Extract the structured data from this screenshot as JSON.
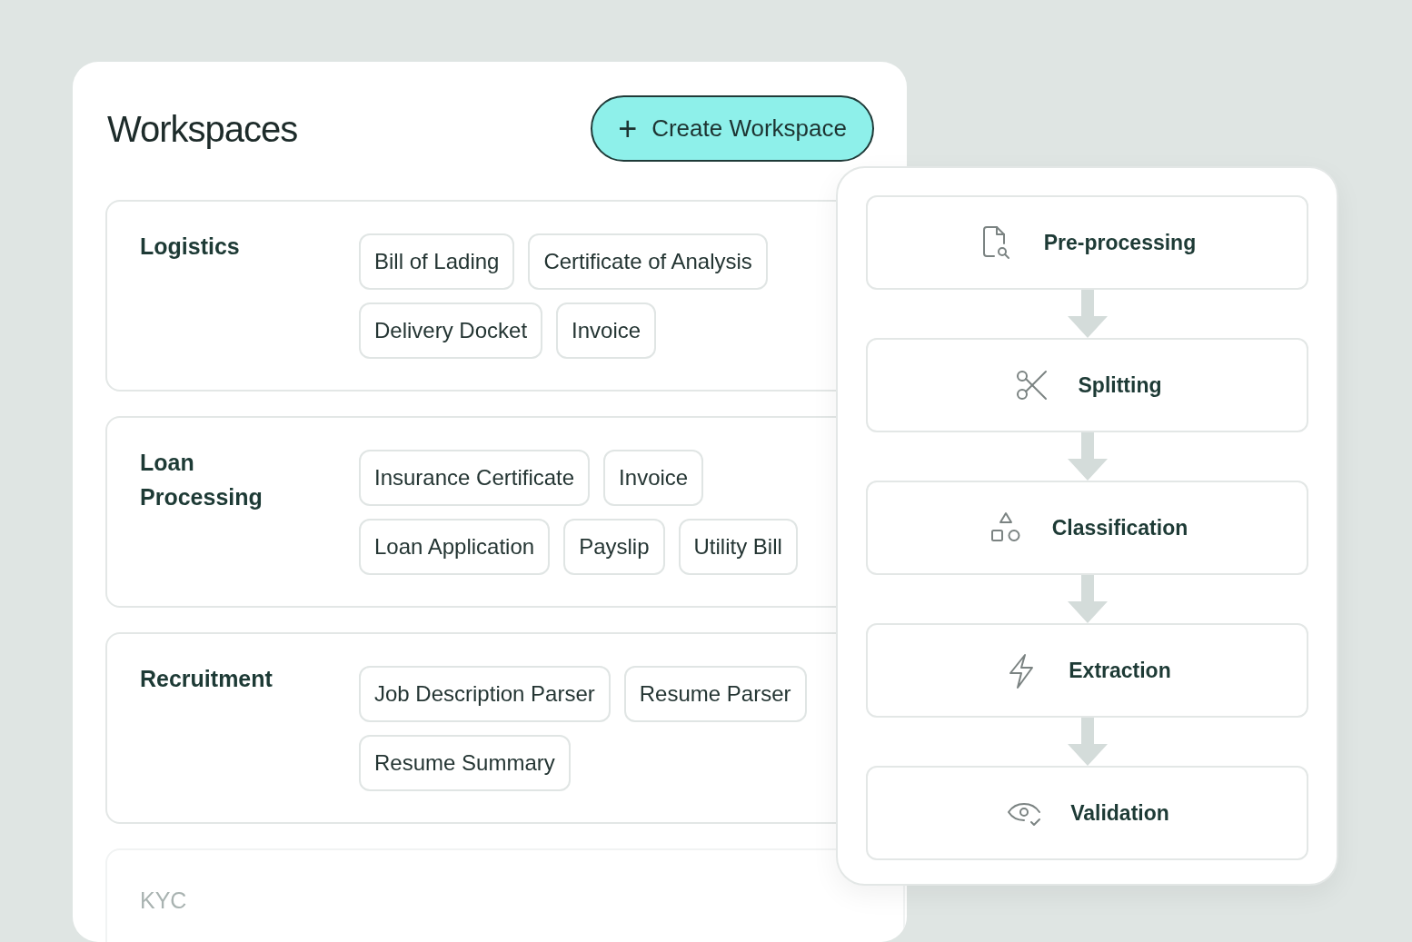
{
  "title": "Workspaces",
  "create_button": {
    "icon": "+",
    "label": "Create Workspace"
  },
  "workspaces": [
    {
      "name": "Logistics",
      "faded": false,
      "tag_rows": [
        [
          "Bill of Lading",
          "Certificate of Analysis"
        ],
        [
          "Delivery Docket",
          "Invoice"
        ]
      ]
    },
    {
      "name": "Loan Processing",
      "faded": false,
      "tag_rows": [
        [
          "Insurance Certificate",
          "Invoice"
        ],
        [
          "Loan Application",
          "Payslip",
          "Utility Bill"
        ]
      ]
    },
    {
      "name": "Recruitment",
      "faded": false,
      "tag_rows": [
        [
          "Job Description Parser",
          "Resume Parser"
        ],
        [
          "Resume Summary"
        ]
      ]
    },
    {
      "name": "KYC",
      "faded": true
    }
  ],
  "pipeline": [
    {
      "kind": "file-search",
      "label": "Pre-processing"
    },
    {
      "kind": "scissors",
      "label": "Splitting"
    },
    {
      "kind": "shapes",
      "label": "Classification"
    },
    {
      "kind": "bolt",
      "label": "Extraction"
    },
    {
      "kind": "eye-check",
      "label": "Validation"
    }
  ]
}
